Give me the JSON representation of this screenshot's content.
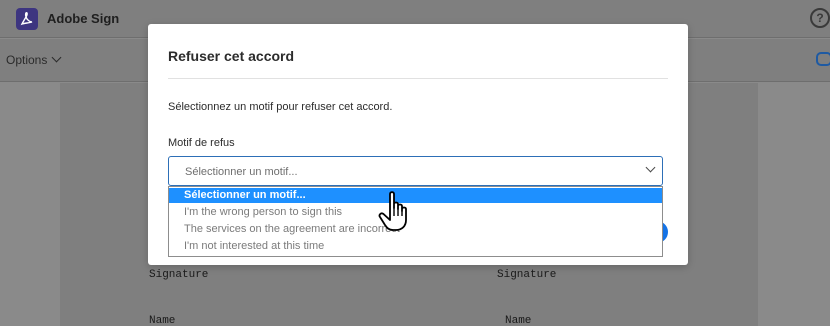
{
  "app": {
    "title": "Adobe Sign",
    "logo_icon": "adobe-acrobat-logo",
    "help_glyph": "?"
  },
  "toolbar": {
    "options_label": "Options"
  },
  "document": {
    "labels": [
      "Signature",
      "Signature",
      "Name",
      "Name"
    ]
  },
  "modal": {
    "title": "Refuser cet accord",
    "description": "Sélectionnez un motif pour refuser cet accord.",
    "field_label": "Motif de refus",
    "select_value": "Sélectionner un motif..."
  },
  "dropdown": {
    "options": [
      "Sélectionner un motif...",
      "I'm the wrong person to sign this",
      "The services on the agreement are incorrect",
      "I'm not interested at this time"
    ],
    "selected_index": 0
  },
  "colors": {
    "accent": "#1473e6",
    "highlight": "#1e90ff",
    "logo": "#3d3580",
    "overlay": "#7f7f7f"
  }
}
